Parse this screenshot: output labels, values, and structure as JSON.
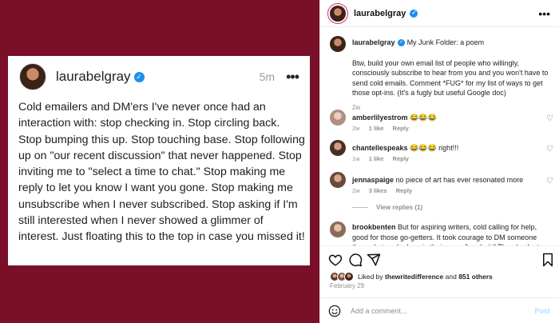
{
  "post_image": {
    "username": "laurabelgray",
    "time": "5m",
    "more": "•••",
    "body": "Cold emailers and DM'ers I've never once had an interaction with: stop checking in. Stop circling back. Stop bumping this up. Stop touching base. Stop following up on \"our recent discussion\" that never happened. Stop inviting me to \"select a time to chat.\" Stop making me reply to let you know I want you gone. Stop making me unsubscribe when I never subscribed. Stop asking if I'm still interested when I never showed a glimmer of interest. Just floating this to the top in case you missed it!",
    "colors": {
      "background": "#7a0f2a",
      "verified": "#1c8ef0"
    }
  },
  "header": {
    "username": "laurabelgray",
    "more": "•••"
  },
  "caption": {
    "username": "laurabelgray",
    "title": "My Junk Folder: a poem",
    "paragraph": "Btw, build your own email list of people who willingly, consciously subscribe to hear from you and you won't have to send cold emails. Comment *FUG* for my list of ways to get those opt-ins. (It's a fugly but useful Google doc)",
    "time": "2w"
  },
  "comments": [
    {
      "username": "amberlilyestrom",
      "text": "😂😂😂",
      "time": "2w",
      "likes": "1 like",
      "reply": "Reply"
    },
    {
      "username": "chantellespeaks",
      "text": "😂😂😂 right!!!",
      "time": "1w",
      "likes": "1 like",
      "reply": "Reply"
    },
    {
      "username": "jennaspaige",
      "text": "no piece of art has ever resonated more",
      "time": "2w",
      "likes": "3 likes",
      "reply": "Reply",
      "view_replies": "View replies (1)"
    },
    {
      "username": "brookbenten",
      "text": "But for aspiring writers, cold calling for help, good for those go-getters. It took courage to DM someone they admire who has, in their eyes, \"made it.\" There's plenty"
    }
  ],
  "likes": {
    "prefix": "Liked by",
    "user": "thewritedifference",
    "and": "and",
    "others": "851 others"
  },
  "date": "February 29",
  "add_comment": {
    "placeholder": "Add a comment...",
    "post_label": "Post"
  },
  "icons": {
    "heart": "heart-icon",
    "comment": "comment-icon",
    "share": "share-icon",
    "save": "bookmark-icon",
    "emoji": "emoji-icon",
    "more": "more-icon",
    "verified": "verified-badge-icon"
  }
}
